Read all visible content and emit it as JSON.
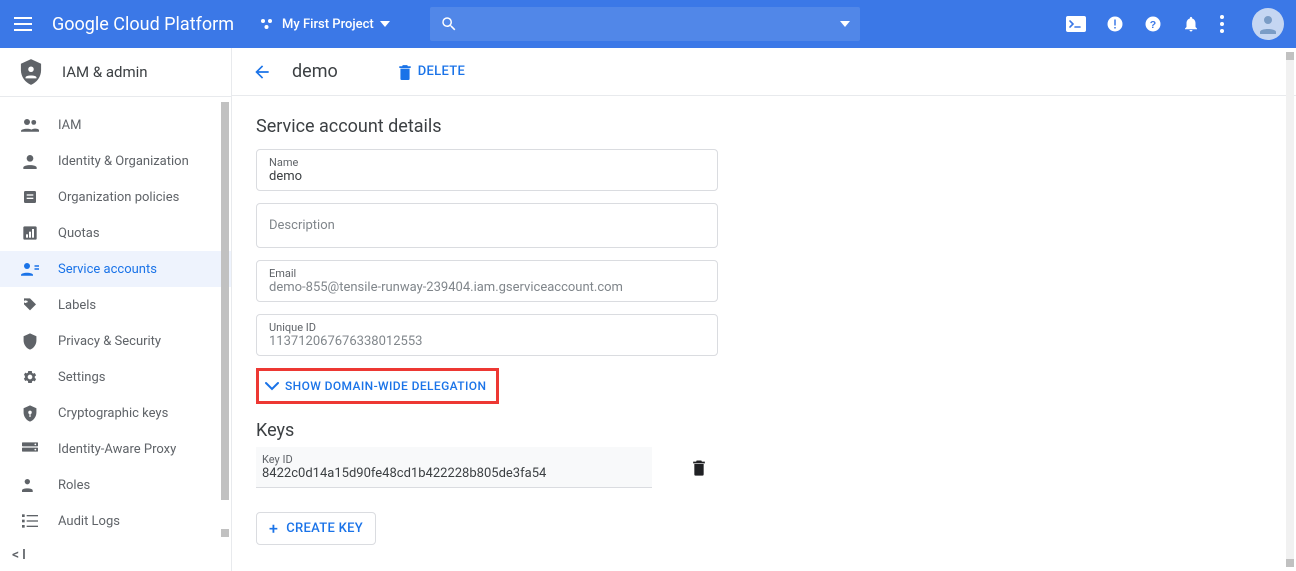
{
  "header": {
    "brand": "Google Cloud Platform",
    "project_name": "My First Project"
  },
  "sidebar": {
    "title": "IAM & admin",
    "items": [
      {
        "label": "IAM"
      },
      {
        "label": "Identity & Organization"
      },
      {
        "label": "Organization policies"
      },
      {
        "label": "Quotas"
      },
      {
        "label": "Service accounts"
      },
      {
        "label": "Labels"
      },
      {
        "label": "Privacy & Security"
      },
      {
        "label": "Settings"
      },
      {
        "label": "Cryptographic keys"
      },
      {
        "label": "Identity-Aware Proxy"
      },
      {
        "label": "Roles"
      },
      {
        "label": "Audit Logs"
      }
    ]
  },
  "page": {
    "title": "demo",
    "delete_label": "DELETE"
  },
  "details": {
    "heading": "Service account details",
    "name_label": "Name",
    "name_value": "demo",
    "description_placeholder": "Description",
    "email_label": "Email",
    "email_value": "demo-855@tensile-runway-239404.iam.gserviceaccount.com",
    "unique_id_label": "Unique ID",
    "unique_id_value": "113712067676338012553",
    "expand_label": "SHOW DOMAIN-WIDE DELEGATION"
  },
  "keys": {
    "heading": "Keys",
    "key_id_label": "Key ID",
    "key_id_value": "8422c0d14a15d90fe48cd1b422228b805de3fa54",
    "create_label": "CREATE KEY"
  }
}
